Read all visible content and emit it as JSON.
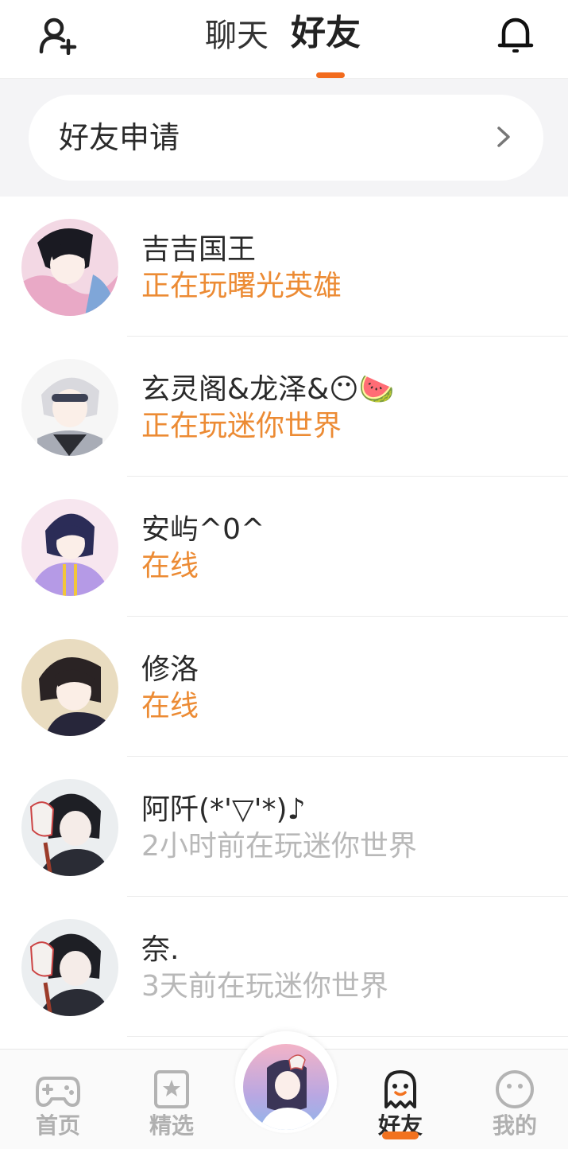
{
  "header": {
    "tabs": [
      {
        "label": "聊天",
        "active": false
      },
      {
        "label": "好友",
        "active": true
      }
    ],
    "left_icon": "add-friend-icon",
    "right_icon": "bell-icon",
    "accent": "#f26b1d"
  },
  "friend_requests": {
    "label": "好友申请",
    "icon": "chevron-right-icon"
  },
  "friends": [
    {
      "name": "吉吉国王",
      "status": "正在玩曙光英雄",
      "online": true
    },
    {
      "name": "玄灵阁&龙泽&😶🍉",
      "status": "正在玩迷你世界",
      "online": true
    },
    {
      "name": "安屿^0^",
      "status": "在线",
      "online": true
    },
    {
      "name": "修洛",
      "status": "在线",
      "online": true
    },
    {
      "name": "阿阡(*'▽'*)♪",
      "status": "2小时前在玩迷你世界",
      "online": false
    },
    {
      "name": "奈.",
      "status": "3天前在玩迷你世界",
      "online": false
    }
  ],
  "colors": {
    "online_status": "#ec8b34",
    "offline_status": "#b8b8b8"
  },
  "bottom_nav": [
    {
      "label": "首页",
      "icon": "gamepad-icon",
      "active": false
    },
    {
      "label": "精选",
      "icon": "star-card-icon",
      "active": false
    },
    {
      "label": "",
      "icon": "center-avatar",
      "active": false
    },
    {
      "label": "好友",
      "icon": "ghost-icon",
      "active": true
    },
    {
      "label": "我的",
      "icon": "smiley-icon",
      "active": false
    }
  ]
}
